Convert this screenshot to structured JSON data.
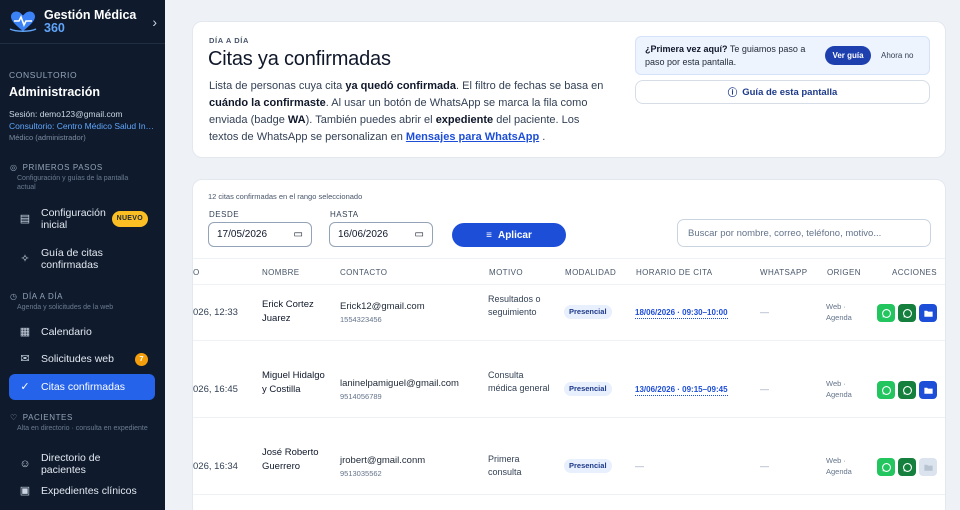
{
  "brand": {
    "name": "Gestión Médica",
    "suffix": "360"
  },
  "sidebar": {
    "section_label": "CONSULTORIO",
    "title": "Administración",
    "session": "Sesión: demo123@gmail.com",
    "consultorio": "Consultorio: Centro Médico Salud Integral",
    "role": "Médico (administrador)",
    "groups": [
      {
        "label": "PRIMEROS PASOS",
        "desc": "Configuración y guías de la pantalla actual",
        "items": [
          {
            "label": "Configuración inicial",
            "icon": "document-icon",
            "badge": "NUEVO"
          },
          {
            "label": "Guía de citas confirmadas",
            "icon": "sparkle-icon"
          }
        ]
      },
      {
        "label": "DÍA A DÍA",
        "desc": "Agenda y solicitudes de la web",
        "items": [
          {
            "label": "Calendario",
            "icon": "calendar-icon"
          },
          {
            "label": "Solicitudes web",
            "icon": "inbox-icon",
            "count": "7"
          },
          {
            "label": "Citas confirmadas",
            "icon": "check-circle-icon",
            "active": true
          }
        ]
      },
      {
        "label": "PACIENTES",
        "desc": "Alta en directorio · consulta en expediente",
        "items": [
          {
            "label": "Directorio de pacientes",
            "icon": "users-icon"
          },
          {
            "label": "Expedientes clínicos",
            "icon": "clipboard-icon"
          }
        ]
      }
    ]
  },
  "hero": {
    "eyebrow": "DÍA A DÍA",
    "title": "Citas ya confirmadas",
    "desc": {
      "p1": "Lista de personas cuya cita ",
      "b1": "ya quedó confirmada",
      "p2": ". El filtro de fechas se basa en ",
      "b2": "cuándo la confirmaste",
      "p3": ". Al usar un botón de WhatsApp se marca la fila como enviada (badge ",
      "b3": "WA",
      "p4": "). También puedes abrir el ",
      "b4": "expediente",
      "p5": " del paciente. Los textos de WhatsApp se personalizan en ",
      "link": "Mensajes para WhatsApp",
      "p6": " ."
    },
    "tour": {
      "question": "¿Primera vez aquí?",
      "text": " Te guiamos paso a paso por esta pantalla.",
      "btn_primary": "Ver guía",
      "btn_later": "Ahora no"
    },
    "guide_button": "Guía de esta pantalla"
  },
  "filters": {
    "count_text": "12 citas confirmadas en el rango seleccionado",
    "desde_label": "DESDE",
    "desde_value": "17/05/2026",
    "hasta_label": "HASTA",
    "hasta_value": "16/06/2026",
    "apply": "Aplicar",
    "search_placeholder": "Buscar por nombre, correo, teléfono, motivo..."
  },
  "table": {
    "headers": {
      "fecha": "O",
      "nombre": "NOMBRE",
      "contacto": "CONTACTO",
      "motivo": "MOTIVO",
      "modalidad": "MODALIDAD",
      "horario": "HORARIO DE CITA",
      "whatsapp": "WHATSAPP",
      "origen": "ORIGEN",
      "acciones": "ACCIONES"
    },
    "rows": [
      {
        "fecha": "026, 12:33",
        "nombre": "Erick Cortez Juarez",
        "email": "Erick12@gmail.com",
        "tel": "1554323456",
        "motivo": "Resultados o seguimiento",
        "modalidad": "Presencial",
        "horario": "18/06/2026 · 09:30–10:00",
        "whatsapp": "—",
        "origen": "Web · Agenda"
      },
      {
        "fecha": "026, 16:45",
        "nombre": "Miguel Hidalgo y Costilla",
        "email": "laninelpamiguel@gmail.com",
        "tel": "9514056789",
        "motivo": "Consulta médica general",
        "modalidad": "Presencial",
        "horario": "13/06/2026 · 09:15–09:45",
        "whatsapp": "—",
        "origen": "Web · Agenda"
      },
      {
        "fecha": "026, 16:34",
        "nombre": "José Roberto Guerrero",
        "email": "jrobert@gmail.conm",
        "tel": "9513035562",
        "motivo": "Primera consulta",
        "modalidad": "Presencial",
        "horario": "—",
        "whatsapp": "—",
        "origen": "Web · Agenda"
      }
    ]
  },
  "colors": {
    "sidebar_bg": "#0f1b2d",
    "accent": "#2563eb",
    "whatsapp": "#22c55e",
    "badge": "#fbbf24"
  }
}
